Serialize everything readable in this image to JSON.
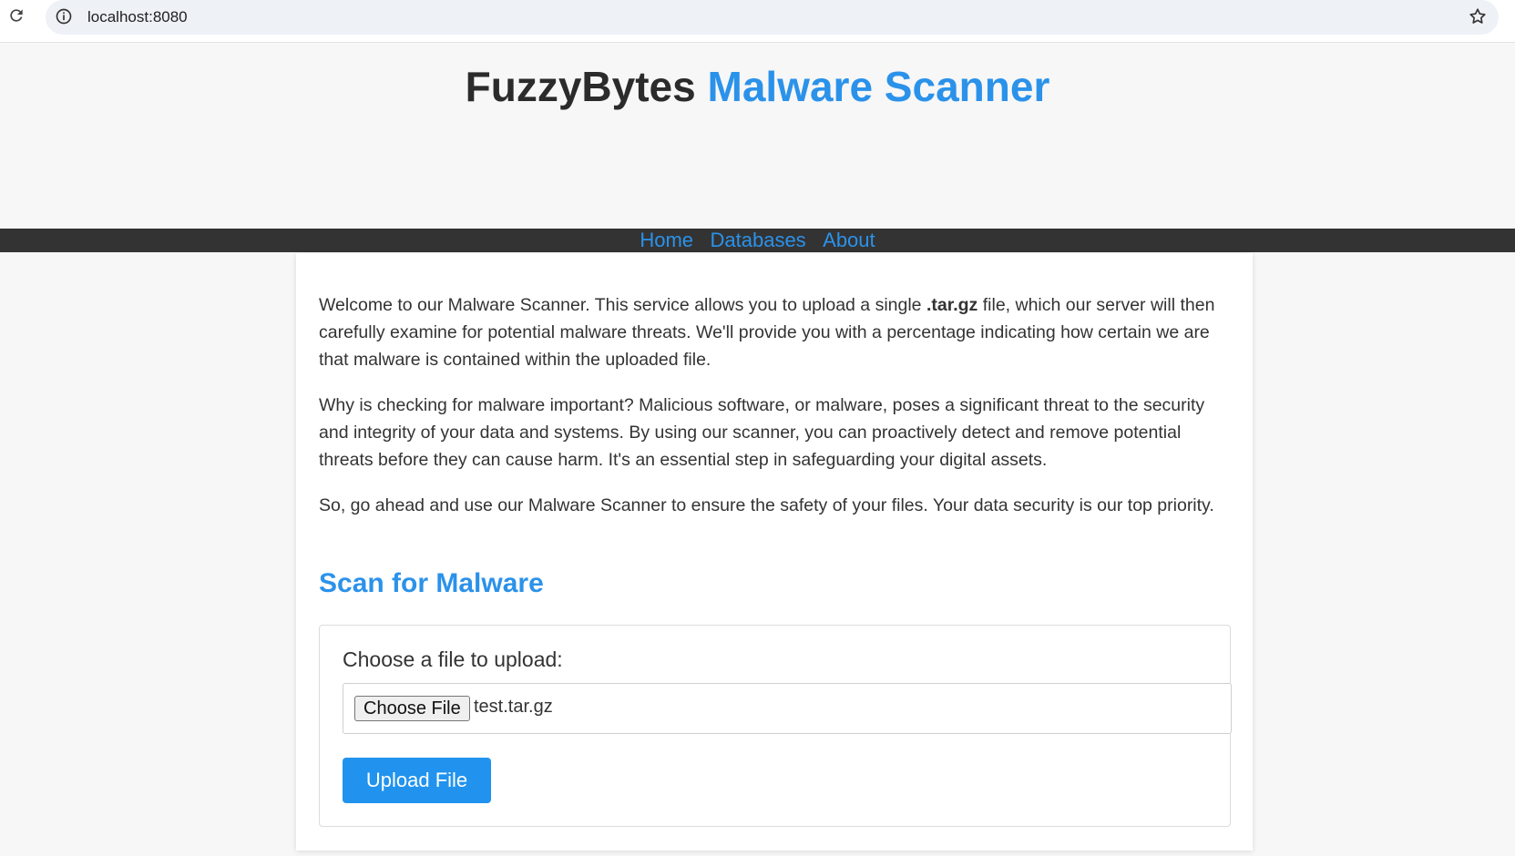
{
  "browser": {
    "url": "localhost:8080"
  },
  "header": {
    "title_main": "FuzzyBytes",
    "title_accent": "Malware Scanner",
    "accent_color": "#2b92ea"
  },
  "nav": {
    "items": [
      {
        "label": "Home"
      },
      {
        "label": "Databases"
      },
      {
        "label": "About"
      }
    ]
  },
  "content": {
    "p1_before": "Welcome to our Malware Scanner. This service allows you to upload a single ",
    "p1_bold": ".tar.gz",
    "p1_after": " file, which our server will then carefully examine for potential malware threats. We'll provide you with a percentage indicating how certain we are that malware is contained within the uploaded file.",
    "p2": "Why is checking for malware important? Malicious software, or malware, poses a significant threat to the security and integrity of your data and systems. By using our scanner, you can proactively detect and remove potential threats before they can cause harm. It's an essential step in safeguarding your digital assets.",
    "p3": "So, go ahead and use our Malware Scanner to ensure the safety of your files. Your data security is our top priority."
  },
  "scan": {
    "title": "Scan for Malware",
    "label": "Choose a file to upload:",
    "choose_button": "Choose File",
    "file_name": "test.tar.gz",
    "upload_button": "Upload File"
  }
}
